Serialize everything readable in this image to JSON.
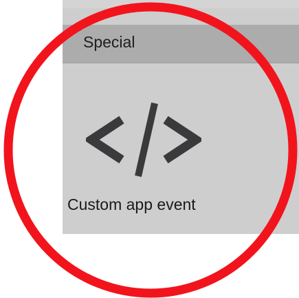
{
  "section": {
    "title": "Special"
  },
  "tile": {
    "label": "Custom app event",
    "icon": "code-icon"
  },
  "colors": {
    "panel": "#cecece",
    "header": "#acacac",
    "icon": "#3a3a3c",
    "ring": "#f2141c"
  }
}
